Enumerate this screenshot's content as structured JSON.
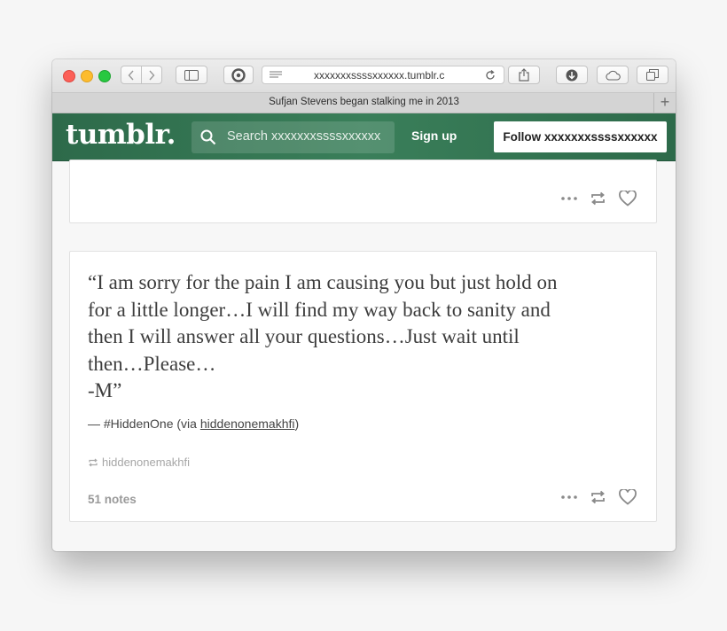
{
  "browser": {
    "address": "xxxxxxxssssxxxxxx.tumblr.c",
    "tab_title": "Sufjan Stevens began stalking me in 2013",
    "new_tab_label": "+"
  },
  "tumblr": {
    "logo": "tumblr.",
    "search_placeholder": "Search xxxxxxxssssxxxxxx",
    "signup_label": "Sign up",
    "follow_label": "Follow xxxxxxxssssxxxxxx"
  },
  "post": {
    "quote_lines": [
      "“I am sorry for the pain I am causing you but just hold on",
      "for a little longer…I will find my way back to sanity and",
      "then I will answer all your questions…Just wait until",
      "then…Please…",
      "-M”"
    ],
    "source_prefix": "— #HiddenOne (via ",
    "source_link": "hiddenonemakhfi",
    "source_suffix": ")",
    "reblogged_from": "hiddenonemakhfi",
    "notes": "51 notes"
  },
  "colors": {
    "header_green": "#35795a",
    "window_bg": "#ffffff"
  }
}
